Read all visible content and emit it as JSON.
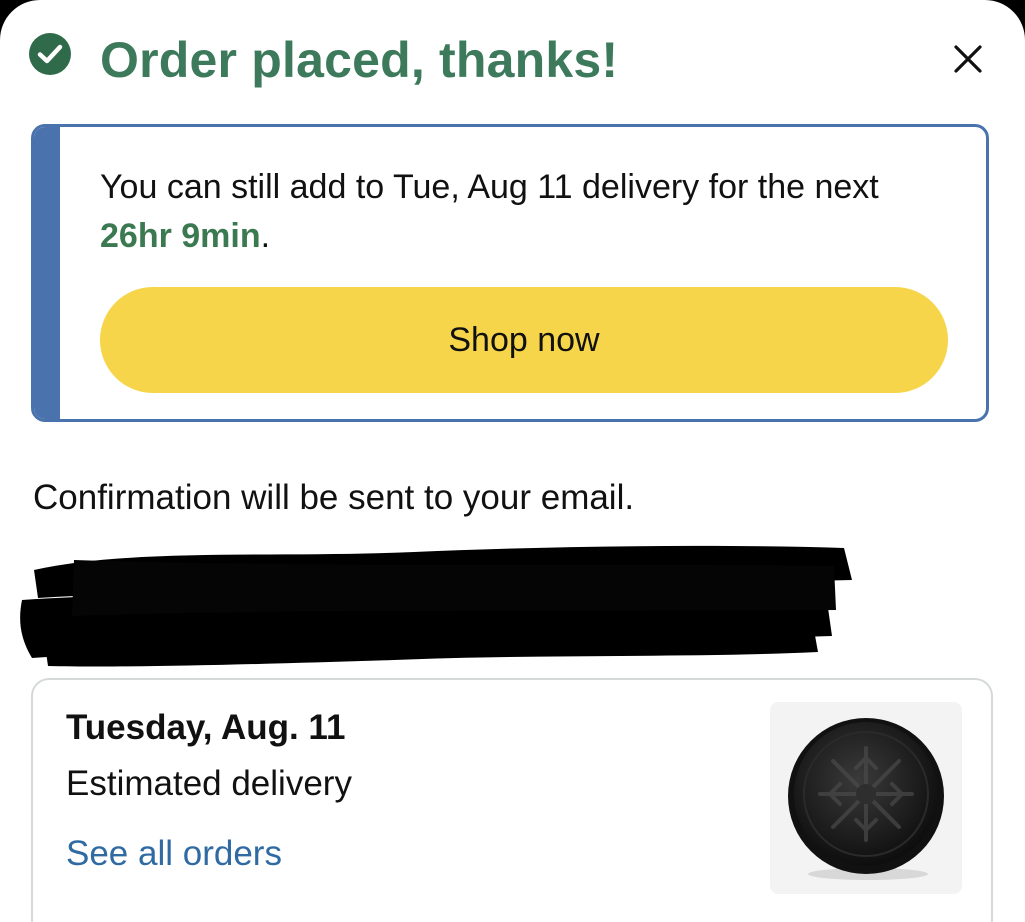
{
  "header": {
    "title": "Order placed, thanks!",
    "status_icon": "check-circle-icon",
    "close_icon": "close-icon",
    "success_color": "#3d7a5c"
  },
  "promo": {
    "text_before": "You can still add to Tue, Aug 11 delivery for the next ",
    "timer": "26hr 9min",
    "text_after": ".",
    "button_label": "Shop now",
    "accent_color": "#4a73ad",
    "button_color": "#f6d54a"
  },
  "confirmation": {
    "message": "Confirmation will be sent to your email."
  },
  "delivery": {
    "date": "Tuesday, Aug. 11",
    "label": "Estimated delivery",
    "link_label": "See all orders",
    "link_color": "#2f6aa3"
  }
}
